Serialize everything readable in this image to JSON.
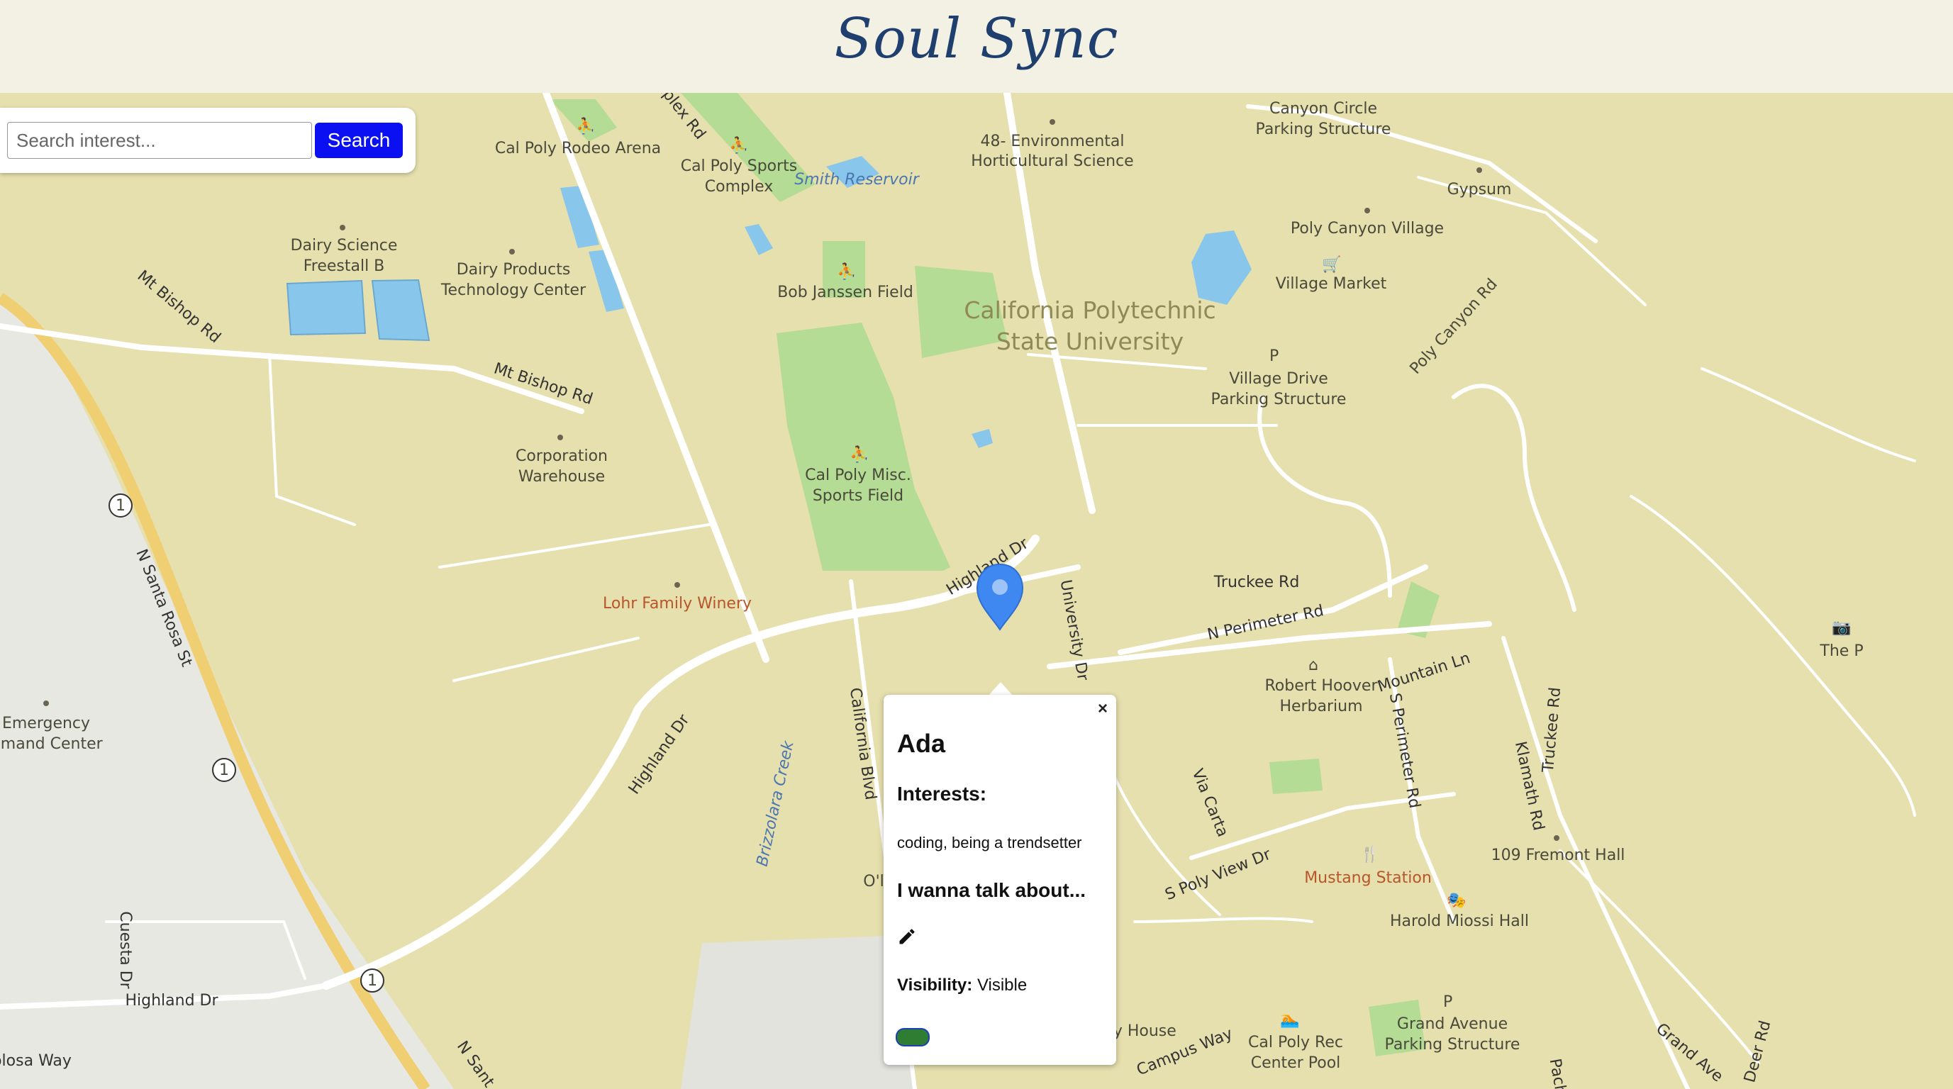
{
  "header": {
    "title": "Soul Sync"
  },
  "search": {
    "placeholder": "Search interest...",
    "button_label": "Search"
  },
  "popup": {
    "close_symbol": "×",
    "name": "Ada",
    "interests_heading": "Interests:",
    "interests_value": "coding, being a trendsetter",
    "talk_heading": "I wanna talk about...",
    "edit_icon": "pencil-icon",
    "visibility_label": "Visibility:",
    "visibility_value": "Visible",
    "toggle_color": "#2e7d32"
  },
  "map": {
    "colors": {
      "land": "#e6dfae",
      "urban": "#e8e8e3",
      "park": "#b5dc95",
      "water": "#88c6ec",
      "highway": "#f0cf73",
      "marker": "#3f88f2"
    },
    "labels": {
      "rodeo_arena": "Cal Poly Rodeo Arena",
      "sports_complex_1": "Cal Poly Sports",
      "sports_complex_2": "Complex",
      "smith_reservoir": "Smith Reservoir",
      "env_hort_1": "48- Environmental",
      "env_hort_2": "Horticultural Science",
      "canyon_circle_1": "Canyon Circle",
      "canyon_circle_2": "Parking Structure",
      "gypsum": "Gypsum",
      "poly_canyon_village": "Poly Canyon Village",
      "village_market": "Village Market",
      "dairy_freestall_1": "Dairy Science",
      "dairy_freestall_2": "Freestall B",
      "dairy_products_1": "Dairy Products",
      "dairy_products_2": "Technology Center",
      "bob_janssen": "Bob Janssen Field",
      "university_1": "California Polytechnic",
      "university_2": "State University",
      "village_drive_1": "Village Drive",
      "village_drive_2": "Parking Structure",
      "poly_canyon_rd": "Poly Canyon Rd",
      "mt_bishop_rd_1": "Mt Bishop Rd",
      "mt_bishop_rd_2": "Mt Bishop Rd",
      "corp_warehouse_1": "Corporation",
      "corp_warehouse_2": "Warehouse",
      "misc_field_1": "Cal Poly Misc.",
      "misc_field_2": "Sports Field",
      "highland_dr_1": "Highland Dr",
      "highland_dr_2": "Highland Dr",
      "highland_dr_3": "Highland Dr",
      "truckee_rd": "Truckee Rd",
      "truckee_rd_2": "Truckee Rd",
      "n_perimeter_rd": "N Perimeter Rd",
      "university_dr": "University Dr",
      "lohr_winery": "Lohr Family Winery",
      "n_santa_rosa": "N Santa Rosa St",
      "n_santa_rosa_2": "N Sant",
      "california_blvd": "California Blvd",
      "brizzolara_creek": "Brizzolara Creek",
      "robert_hoover_1": "Robert Hoover",
      "robert_hoover_2": "Herbarium",
      "mountain_ln": "Mountain Ln",
      "s_perimeter_rd": "S Perimeter Rd",
      "klamath_rd": "Klamath Rd",
      "the_p": "The P",
      "emergency_1": "Emergency",
      "emergency_2": "mmand Center",
      "via_carta": "Via Carta",
      "s_poly_view_dr": "S Poly View Dr",
      "mustang_station": "Mustang Station",
      "fremont_hall": "109 Fremont Hall",
      "miossi_hall": "Harold Miossi Hall",
      "cuesta_dr": "Cuesta Dr",
      "grand_ave_ps_1": "Grand Avenue",
      "grand_ave_ps_2": "Parking Structure",
      "grand_ave": "Grand Ave",
      "deer_rd": "Deer Rd",
      "rec_center_1": "Cal Poly Rec",
      "rec_center_2": "Center Pool",
      "campus_way": "Campus Way",
      "ty_house": "ty House",
      "olosa_way": "olosa Way",
      "o_partial": "O'l",
      "complex_rd": "nplex Rd",
      "pach": "Pach",
      "highway_number": "1"
    }
  }
}
